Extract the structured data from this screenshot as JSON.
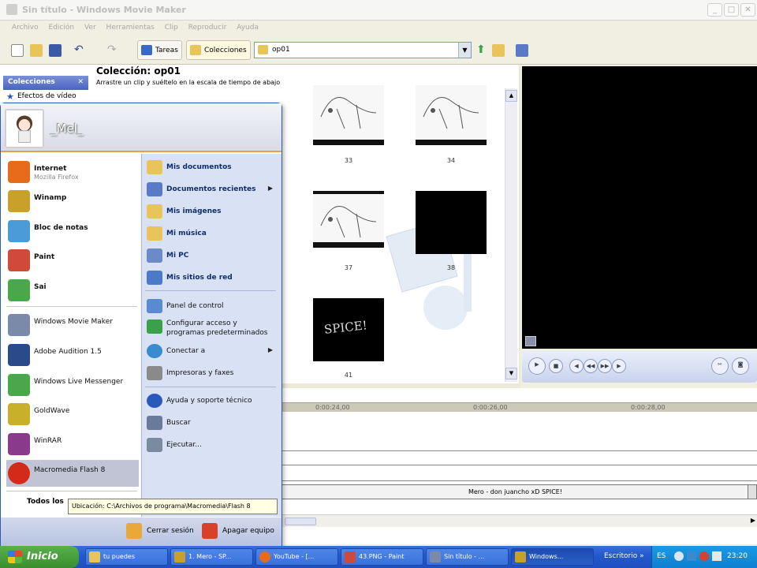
{
  "window": {
    "title": "Sin título - Windows Movie Maker"
  },
  "menu": [
    "Archivo",
    "Edición",
    "Ver",
    "Herramientas",
    "Clip",
    "Reproducir",
    "Ayuda"
  ],
  "toolbar": {
    "tareas_label": "Tareas",
    "colecciones_label": "Colecciones",
    "combo_value": "op01"
  },
  "tasks": {
    "header": "Colecciones",
    "item": "Efectos de vídeo"
  },
  "collection": {
    "title": "Colección: op01",
    "subtitle": "Arrastre un clip y suéltelo en la escala de tiempo de abajo",
    "clips": [
      {
        "num": "33",
        "kind": "sketch"
      },
      {
        "num": "34",
        "kind": "sketch"
      },
      {
        "num": "37",
        "kind": "sketch"
      },
      {
        "num": "38",
        "kind": "black"
      },
      {
        "num": "41",
        "kind": "spice"
      }
    ],
    "spice_text": "SPICE!"
  },
  "timeline": {
    "ruler": [
      "0:00:24,00",
      "0:00:26,00",
      "0:00:28,00"
    ],
    "music_clip": "Mero - don juancho xD SPICE!"
  },
  "startmenu": {
    "user": "_Mel_",
    "pinned": [
      {
        "name": "Internet",
        "sub": "Mozilla Firefox",
        "color": "#e66b1a"
      },
      {
        "name": "Winamp",
        "sub": "",
        "color": "#c9a12a"
      },
      {
        "name": "Bloc de notas",
        "sub": "",
        "color": "#4a9bd8"
      },
      {
        "name": "Paint",
        "sub": "",
        "color": "#d04a3a"
      },
      {
        "name": "Sai",
        "sub": "",
        "color": "#4aa84a"
      }
    ],
    "recent": [
      {
        "name": "Windows Movie Maker",
        "color": "#7a8aa8"
      },
      {
        "name": "Adobe Audition 1.5",
        "color": "#2a4a8a"
      },
      {
        "name": "Windows Live Messenger",
        "color": "#4aa84a"
      },
      {
        "name": "GoldWave",
        "color": "#c8b02a"
      },
      {
        "name": "WinRAR",
        "color": "#8a3a8a"
      },
      {
        "name": "Macromedia Flash 8",
        "color": "#d42a1a"
      }
    ],
    "all_programs": "Todos los",
    "tooltip": "Ubicación: C:\\Archivos de programa\\Macromedia\\Flash 8",
    "right": [
      {
        "name": "Mis documentos",
        "bold": true,
        "arrow": false,
        "color": "#e8c45a"
      },
      {
        "name": "Documentos recientes",
        "bold": true,
        "arrow": true,
        "color": "#5a7ac8"
      },
      {
        "name": "Mis imágenes",
        "bold": true,
        "arrow": false,
        "color": "#e8c45a"
      },
      {
        "name": "Mi música",
        "bold": true,
        "arrow": false,
        "color": "#e8c45a"
      },
      {
        "name": "Mi PC",
        "bold": true,
        "arrow": false,
        "color": "#6a8ac8"
      },
      {
        "name": "Mis sitios de red",
        "bold": true,
        "arrow": false,
        "color": "#4a7ac8"
      },
      {
        "name": "Panel de control",
        "bold": false,
        "arrow": false,
        "color": "#5a8ad0"
      },
      {
        "name": "Configurar acceso y",
        "name2": "programas predeterminados",
        "bold": false,
        "arrow": false,
        "color": "#3aa04a"
      },
      {
        "name": "Conectar a",
        "bold": false,
        "arrow": true,
        "color": "#3a8ad0"
      },
      {
        "name": "Impresoras y faxes",
        "bold": false,
        "arrow": false,
        "color": "#8a8a8a"
      },
      {
        "name": "Ayuda y soporte técnico",
        "bold": false,
        "arrow": false,
        "color": "#2a5ab8"
      },
      {
        "name": "Buscar",
        "bold": false,
        "arrow": false,
        "color": "#6a7a9a"
      },
      {
        "name": "Ejecutar...",
        "bold": false,
        "arrow": false,
        "color": "#7a8aa0"
      }
    ],
    "logoff": "Cerrar sesión",
    "shutdown": "Apagar equipo"
  },
  "taskbar": {
    "start": "Inicio",
    "items": [
      {
        "label": "tu puedes",
        "color": "#e8c45a"
      },
      {
        "label": "1. Mero - SP...",
        "color": "#c9a12a"
      },
      {
        "label": "YouTube - [...",
        "color": "#e66b1a"
      },
      {
        "label": "43.PNG - Paint",
        "color": "#d04a3a"
      },
      {
        "label": "Sin título - ...",
        "color": "#7a8aa8"
      },
      {
        "label": "Windows...",
        "color": "#c9a12a"
      }
    ],
    "desktop": "Escritorio",
    "lang": "ES",
    "clock": "23:20"
  }
}
